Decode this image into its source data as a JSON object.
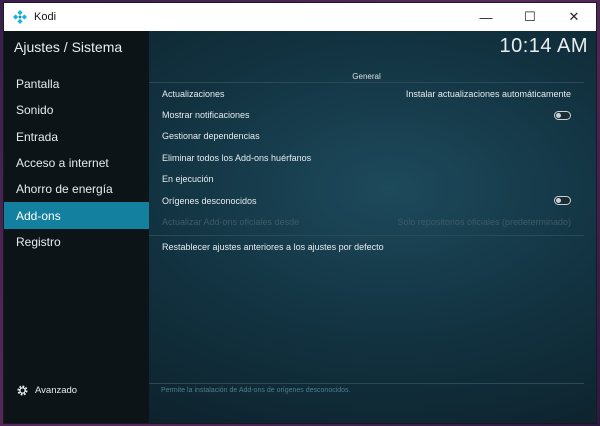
{
  "window": {
    "title": "Kodi",
    "icon": "kodi-logo-icon",
    "controls": {
      "minimize": "—",
      "maximize": "☐",
      "close": "✕"
    }
  },
  "header": {
    "title": "Ajustes / Sistema",
    "clock": "10:14 AM"
  },
  "sidebar": {
    "items": [
      {
        "label": "Pantalla",
        "active": false
      },
      {
        "label": "Sonido",
        "active": false
      },
      {
        "label": "Entrada",
        "active": false
      },
      {
        "label": "Acceso a internet",
        "active": false
      },
      {
        "label": "Ahorro de energía",
        "active": false
      },
      {
        "label": "Add-ons",
        "active": true
      },
      {
        "label": "Registro",
        "active": false
      }
    ],
    "advanced_label": "Avanzado"
  },
  "panel": {
    "section": "General",
    "rows": [
      {
        "label": "Actualizaciones",
        "value": "Instalar actualizaciones automáticamente"
      },
      {
        "label": "Mostrar notificaciones",
        "toggle": false
      },
      {
        "label": "Gestionar dependencias"
      },
      {
        "label": "Eliminar todos los Add-ons huérfanos"
      },
      {
        "label": "En ejecución"
      },
      {
        "label": "Orígenes desconocidos",
        "toggle": false
      },
      {
        "label": "Actualizar Add-ons oficiales desde",
        "value": "Solo repositorios oficiales (predeterminado)",
        "disabled": true
      }
    ],
    "reset_label": "Restablecer ajustes anteriores a los ajustes por defecto"
  },
  "footer": {
    "help_text": "Permite la instalación de Add-ons de orígenes desconocidos."
  },
  "colors": {
    "accent": "#12809e",
    "sidebar_bg": "#0c1418",
    "content_bg": "#123240"
  }
}
